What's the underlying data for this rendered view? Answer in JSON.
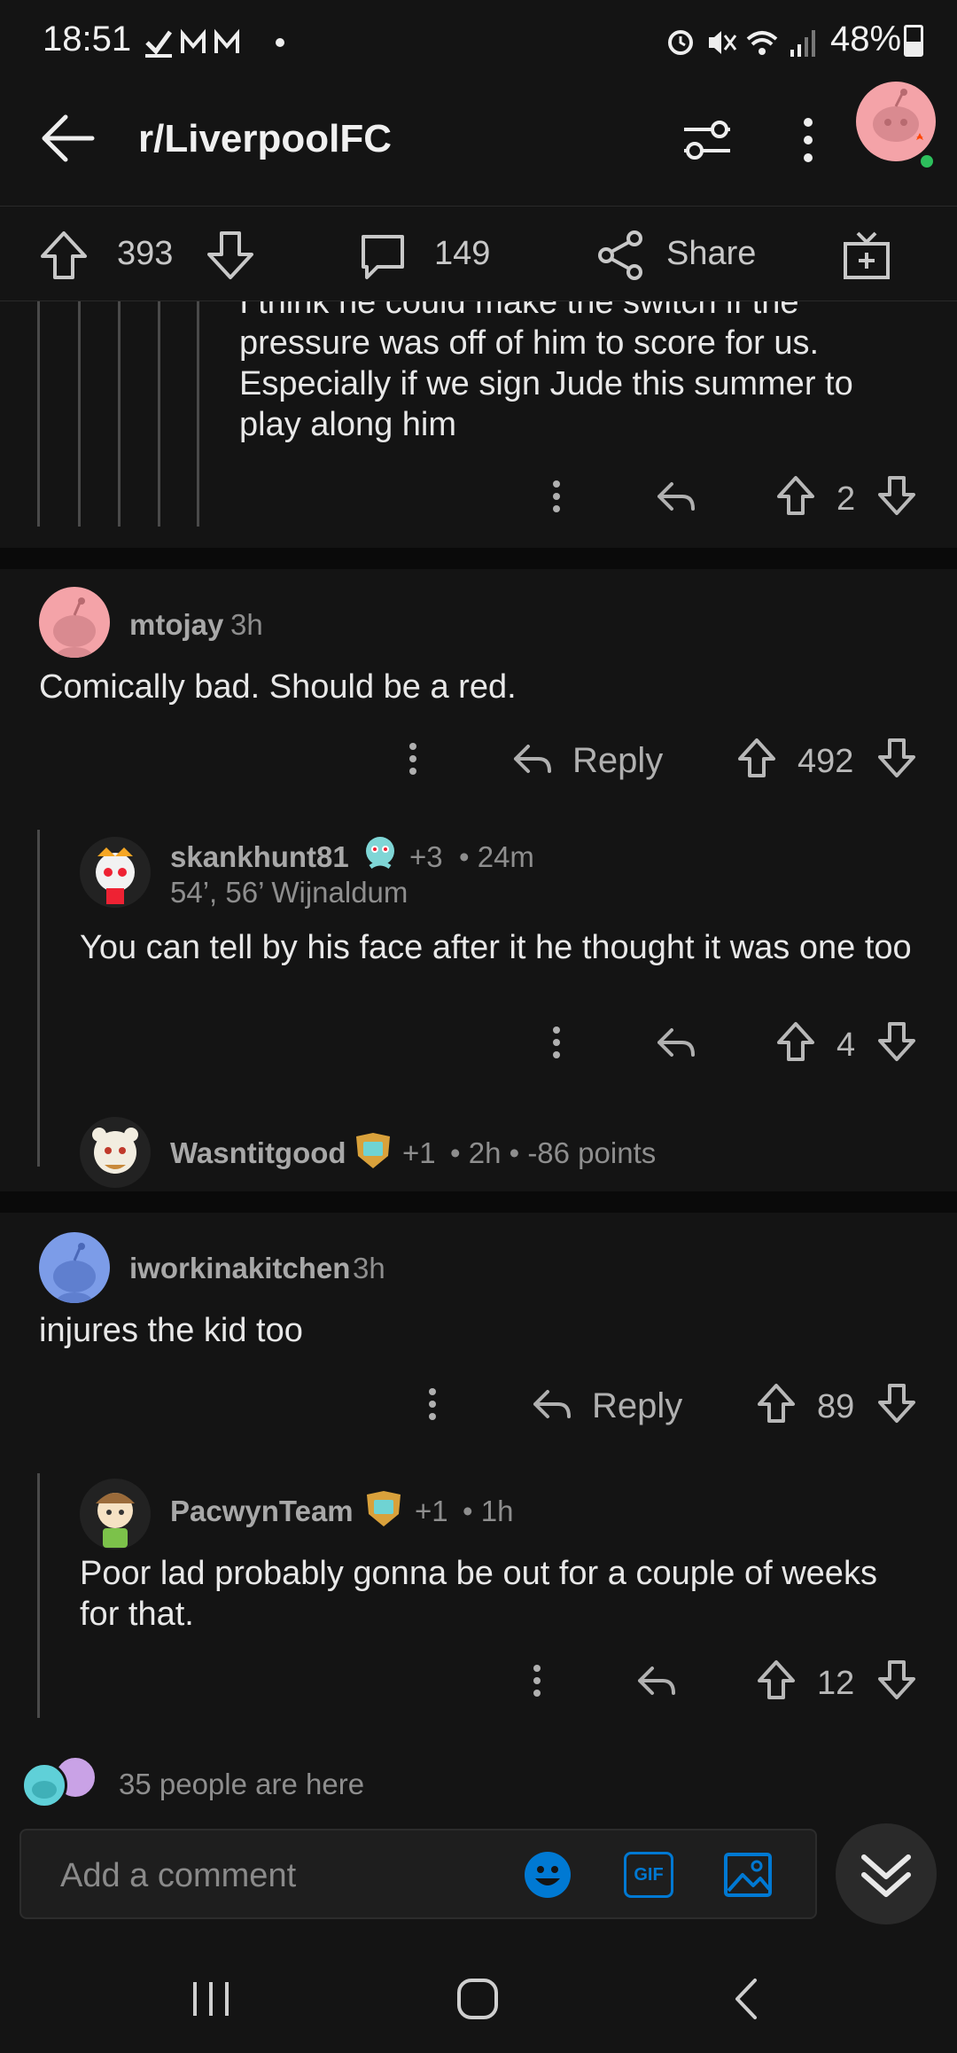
{
  "status_bar": {
    "time": "18:51",
    "battery": "48%"
  },
  "header": {
    "subreddit": "r/LiverpoolFC"
  },
  "post_actions": {
    "upvotes": "393",
    "comments": "149",
    "share_label": "Share"
  },
  "partial_comment": {
    "text_lines": [
      "I think he could make the switch if the",
      "pressure was off of him to score for us.",
      "Especially if we sign Jude this summer to",
      "play along him"
    ],
    "votes": "2"
  },
  "comments": [
    {
      "username": "mtojay",
      "time": "3h",
      "text": "Comically bad. Should be a red.",
      "reply_label": "Reply",
      "votes": "492",
      "replies": [
        {
          "username": "skankhunt81",
          "extra": "+3",
          "time": "• 24m",
          "flair": "54’, 56’ Wijnaldum",
          "text": "You can tell by his face after it he thought it was one too",
          "votes": "4"
        },
        {
          "username": "Wasntitgood",
          "extra": "+1",
          "time": "• 2h • -86 points"
        }
      ]
    },
    {
      "username": "iworkinakitchen",
      "time": "3h",
      "text": "injures the kid too",
      "reply_label": "Reply",
      "votes": "89",
      "replies": [
        {
          "username": "PacwynTeam",
          "extra": "+1",
          "time": "• 1h",
          "text": "Poor lad probably gonna be out for a couple of weeks for that.",
          "votes": "12"
        }
      ]
    }
  ],
  "presence": {
    "text": "35 people are here"
  },
  "composer": {
    "placeholder": "Add a comment",
    "gif_label": "GIF"
  },
  "colors": {
    "background": "#141414",
    "accent_blue": "#0079d3",
    "avatar_pink": "#f4a3a8",
    "avatar_blue": "#7c9ce8"
  },
  "icons": [
    "back-arrow-icon",
    "filter-icon",
    "more-vertical-icon",
    "upvote-icon",
    "downvote-icon",
    "comment-icon",
    "share-icon",
    "gift-icon",
    "reply-arrow-icon",
    "emoji-icon",
    "gif-icon",
    "image-icon",
    "collapse-chevrons-icon"
  ]
}
